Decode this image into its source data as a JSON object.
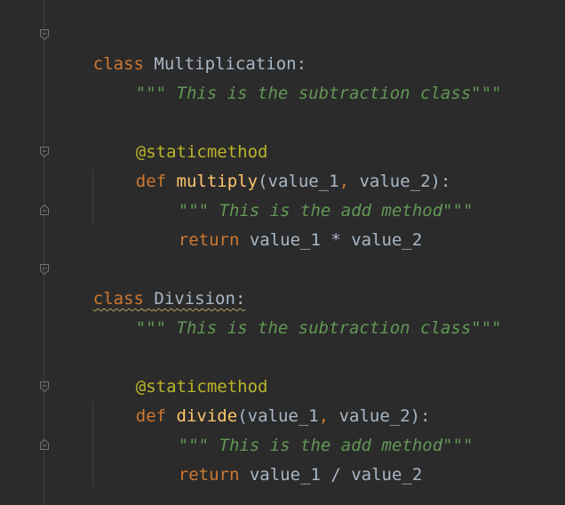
{
  "colors": {
    "background": "#2b2b2b",
    "keyword": "#cc7832",
    "function_name": "#ffc66d",
    "decorator": "#bbb529",
    "docstring": "#629755",
    "text": "#a9b7c6"
  },
  "code": {
    "class1": {
      "keyword": "class",
      "name": "Multiplication",
      "colon": ":",
      "docstring": "\"\"\" This is the subtraction class\"\"\"",
      "decorator": "@staticmethod",
      "def_keyword": "def",
      "method_name": "multiply",
      "params_open": "(value_1",
      "comma": ",",
      "params_rest": " value_2):",
      "method_docstring": "\"\"\" This is the add method\"\"\"",
      "return_keyword": "return",
      "return_expr": " value_1 * value_2"
    },
    "class2": {
      "keyword": "class",
      "name": "Division",
      "colon": ":",
      "docstring": "\"\"\" This is the subtraction class\"\"\"",
      "decorator": "@staticmethod",
      "def_keyword": "def",
      "method_name": "divide",
      "params_open": "(value_1",
      "comma": ",",
      "params_rest": " value_2):",
      "method_docstring": "\"\"\" This is the add method\"\"\"",
      "return_keyword": "return",
      "return_expr": " value_1 / value_2"
    }
  },
  "icons": {
    "fold_open": "fold-open-icon",
    "fold_end": "fold-end-icon"
  }
}
